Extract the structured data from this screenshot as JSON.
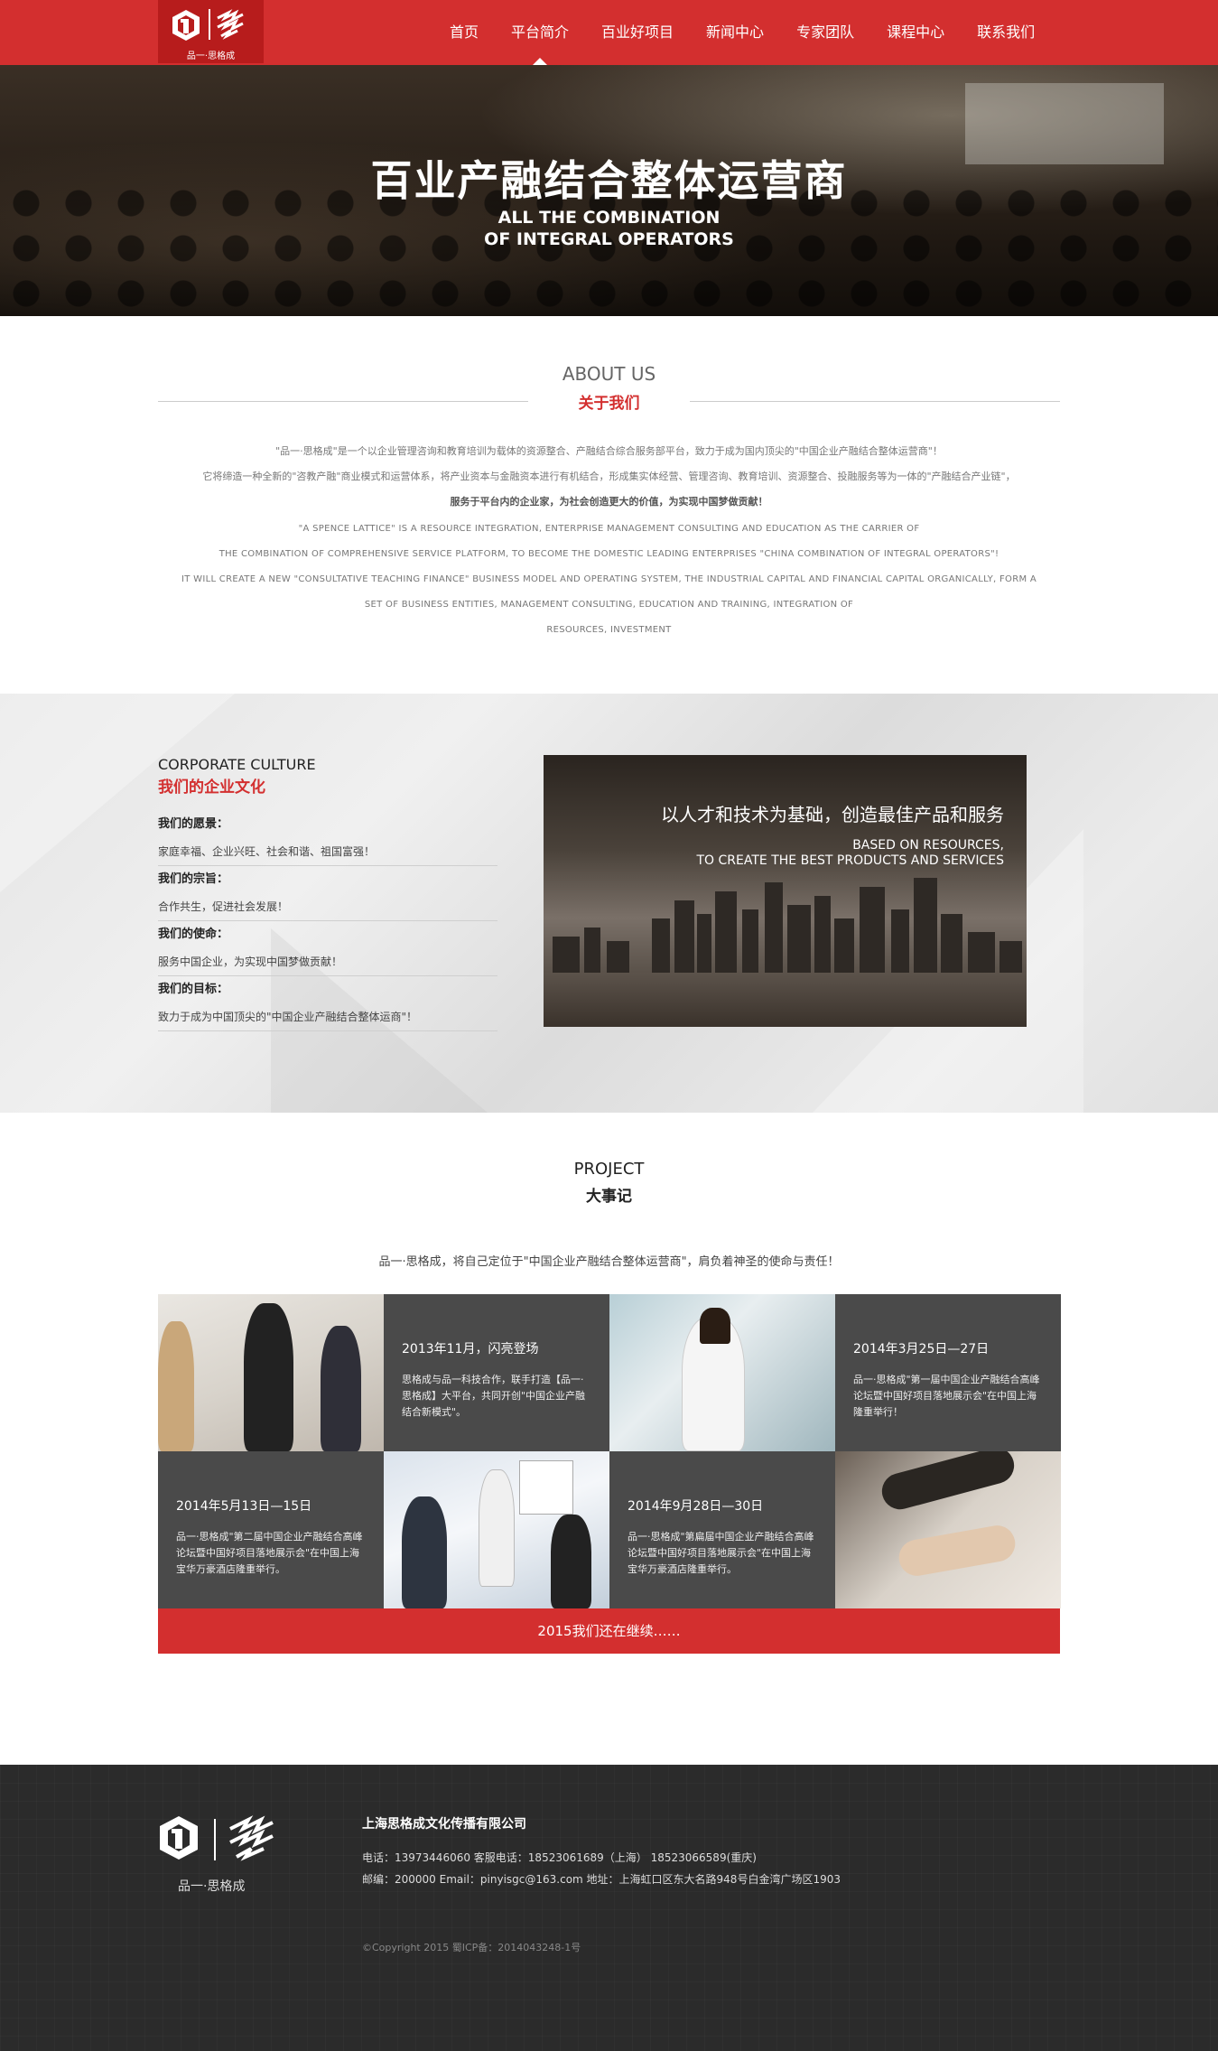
{
  "header": {
    "logo_text": "品一·思格成",
    "nav": [
      "首页",
      "平台简介",
      "百业好项目",
      "新闻中心",
      "专家团队",
      "课程中心",
      "联系我们"
    ],
    "active_index": 1
  },
  "banner": {
    "title": "百业产融结合整体运营商",
    "sub1": "ALL THE COMBINATION",
    "sub2": "OF INTEGRAL OPERATORS"
  },
  "about": {
    "title_en": "ABOUT US",
    "title_cn": "关于我们",
    "cn_line1": "\"品一·思格成\"是一个以企业管理咨询和教育培训为载体的资源整合、产融结合综合服务部平台，致力于成为国内顶尖的\"中国企业产融结合整体运营商\"！",
    "cn_line2": "它将缔造一种全新的\"咨教产融\"商业模式和运营体系，将产业资本与金融资本进行有机结合，形成集实体经营、管理咨询、教育培训、资源整合、投融服务等为一体的\"产融结合产业链\"，",
    "cn_line3": "服务于平台内的企业家，为社会创造更大的价值，为实现中国梦做贡献！",
    "en_line1": "\"A SPENCE LATTICE\" IS A RESOURCE INTEGRATION, ENTERPRISE MANAGEMENT CONSULTING AND EDUCATION AS THE CARRIER OF",
    "en_line2": "THE COMBINATION OF COMPREHENSIVE SERVICE PLATFORM, TO BECOME THE DOMESTIC LEADING ENTERPRISES \"CHINA COMBINATION OF INTEGRAL OPERATORS\"!",
    "en_line3": "IT WILL CREATE A NEW \"CONSULTATIVE TEACHING FINANCE\" BUSINESS MODEL AND OPERATING SYSTEM, THE INDUSTRIAL CAPITAL AND FINANCIAL CAPITAL ORGANICALLY, FORM A",
    "en_line4": "SET OF BUSINESS ENTITIES, MANAGEMENT CONSULTING, EDUCATION AND TRAINING, INTEGRATION OF",
    "en_line5": "RESOURCES, INVESTMENT"
  },
  "culture": {
    "title_en": "CORPORATE CULTURE",
    "title_cn": "我们的企业文化",
    "items": [
      {
        "heading": "我们的愿景：",
        "value": "家庭幸福、企业兴旺、社会和谐、祖国富强！"
      },
      {
        "heading": "我们的宗旨：",
        "value": "合作共生，促进社会发展！"
      },
      {
        "heading": "我们的使命：",
        "value": "服务中国企业，为实现中国梦做贡献！"
      },
      {
        "heading": "我们的目标：",
        "value": "致力于成为中国顶尖的\"中国企业产融结合整体运商\"！"
      }
    ],
    "image_cn": "以人才和技术为基础，创造最佳产品和服务",
    "image_en1": "BASED ON RESOURCES,",
    "image_en2": "TO CREATE THE BEST PRODUCTS AND SERVICES"
  },
  "project": {
    "title_en": "PROJECT",
    "title_cn": "大事记",
    "intro": "品一·思格成，将自己定位于\"中国企业产融结合整体运营商\"，肩负着神圣的使命与责任！",
    "events": [
      {
        "date": "2013年11月，闪亮登场",
        "desc": "思格成与品一科技合作，联手打造【品一·思格成】大平台，共同开创\"中国企业产融结合新模式\"。"
      },
      {
        "date": "2014年3月25日—27日",
        "desc": "品一·思格成\"第一届中国企业产融结合高峰论坛暨中国好项目落地展示会\"在中国上海隆重举行！"
      },
      {
        "date": "2014年5月13日—15日",
        "desc": "品一·思格成\"第二届中国企业产融结合高峰论坛暨中国好项目落地展示会\"在中国上海宝华万豪酒店隆重举行。"
      },
      {
        "date": "2014年9月28日—30日",
        "desc": "品一·思格成\"第扁届中国企业产融结合高峰论坛暨中国好项目落地展示会\"在中国上海宝华万豪酒店隆重举行。"
      }
    ],
    "continue": "2015我们还在继续……"
  },
  "footer": {
    "logo_text": "品一·思格成",
    "company": "上海思格成文化传播有限公司",
    "line1": "电话：13973446060    客服电话：18523061689（上海）  18523066589(重庆)",
    "line2": "邮编：200000    Email：pinyisgc@163.com    地址：上海虹口区东大名路948号白金湾广场区1903",
    "copyright": "©Copyright 2015 蜀ICP备：2014043248-1号"
  },
  "colors": {
    "brand_red": "#d32f2f",
    "dark_red": "#b71c1c",
    "footer_bg": "#2b2b2b",
    "tile_gray": "#4a4a4a"
  }
}
